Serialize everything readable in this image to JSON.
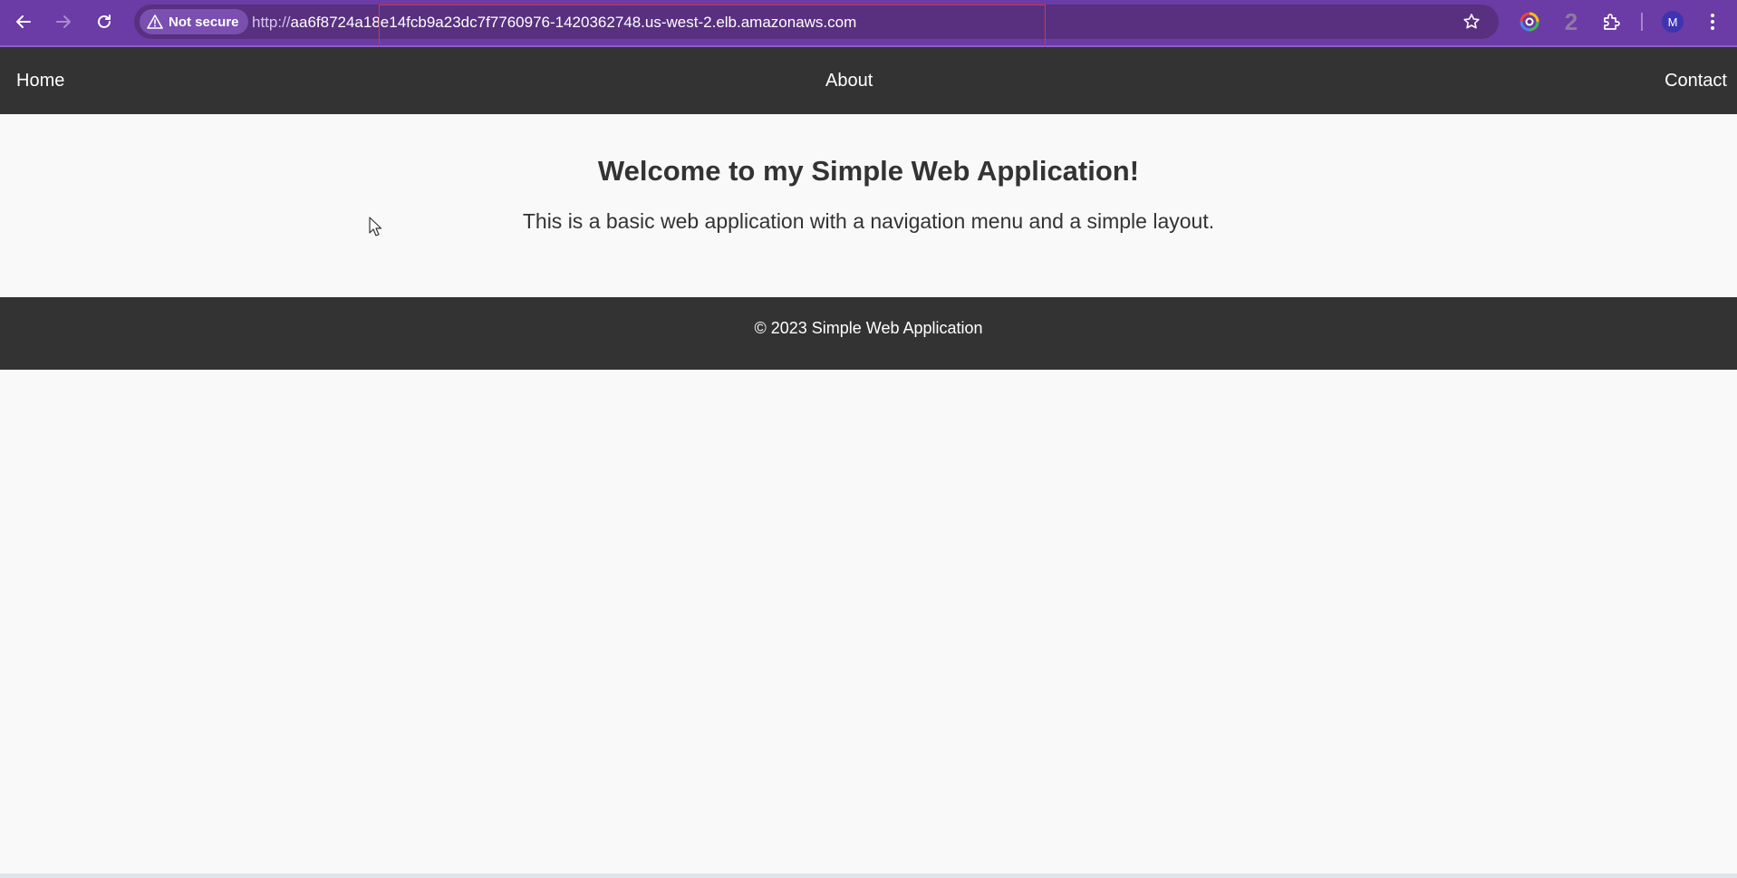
{
  "browser": {
    "security_label": "Not secure",
    "url_scheme": "http://",
    "url_host": "aa6f8724a18e14fcb9a23dc7f7760976-1420362748.us-west-2.elb.amazonaws.com",
    "extension_badge": "2",
    "profile_initial": "M",
    "icons": [
      "back-icon",
      "forward-icon",
      "reload-icon",
      "warning-icon",
      "star-icon",
      "color-extension-icon",
      "puzzle-icon",
      "kebab-menu-icon"
    ]
  },
  "nav": {
    "home": "Home",
    "about": "About",
    "contact": "Contact"
  },
  "main": {
    "heading": "Welcome to my Simple Web Application!",
    "description": "This is a basic web application with a navigation menu and a simple layout."
  },
  "footer": {
    "text": "© 2023 Simple Web Application"
  },
  "colors": {
    "toolbar": "#6b3ba6",
    "omnibox": "#58307f",
    "nav_bg": "#333333",
    "page_bg": "#f9f9f9",
    "highlight": "#e0323c"
  }
}
